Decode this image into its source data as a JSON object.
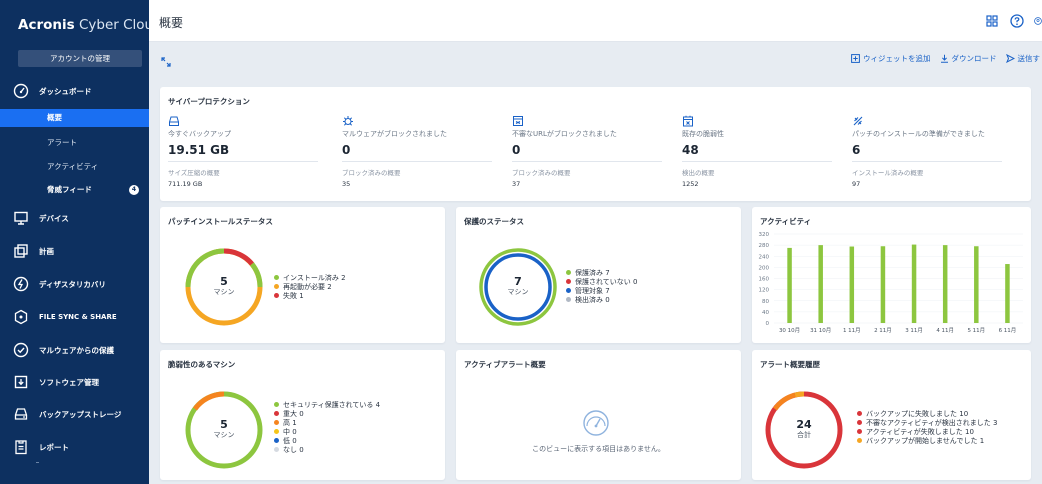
{
  "brand": {
    "name_bold": "Acronis",
    "name_rest": " Cyber Cloud"
  },
  "sidebar": {
    "account_button": "アカウントの管理",
    "items": [
      {
        "label": "ダッシュボード",
        "icon": "dashboard-icon"
      },
      {
        "label": "デバイス",
        "icon": "monitor-icon"
      },
      {
        "label": "計画",
        "icon": "plans-icon"
      },
      {
        "label": "ディザスタリカバリ",
        "icon": "disaster-recovery-icon"
      },
      {
        "label": "FILE SYNC & SHARE",
        "icon": "file-sync-icon"
      },
      {
        "label": "マルウェアからの保護",
        "icon": "shield-check-icon"
      },
      {
        "label": "ソフトウェア管理",
        "icon": "software-icon"
      },
      {
        "label": "バックアップストレージ",
        "icon": "storage-icon"
      },
      {
        "label": "レポート",
        "icon": "report-icon"
      }
    ],
    "sub_items": [
      {
        "label": "概要",
        "active": true
      },
      {
        "label": "アラート"
      },
      {
        "label": "アクティビティ"
      },
      {
        "label": "脅威フィード",
        "badge": "4"
      }
    ]
  },
  "header": {
    "title": "概要"
  },
  "toolbar": {
    "add_widget": "ウィジェットを追加",
    "download": "ダウンロード",
    "send": "送信す"
  },
  "protection": {
    "title": "サイバープロテクション",
    "columns": [
      {
        "label": "今すぐバックアップ",
        "value": "19.51 GB",
        "sub_label": "サイズ圧縮の概要",
        "sub_value": "711.19 GB",
        "icon": "backup-icon"
      },
      {
        "label": "マルウェアがブロックされました",
        "value": "0",
        "sub_label": "ブロック済みの概要",
        "sub_value": "35",
        "icon": "malware-icon"
      },
      {
        "label": "不審なURLがブロックされました",
        "value": "0",
        "sub_label": "ブロック済みの概要",
        "sub_value": "37",
        "icon": "url-block-icon"
      },
      {
        "label": "既存の脆弱性",
        "value": "48",
        "sub_label": "検出の概要",
        "sub_value": "1252",
        "icon": "vulnerability-icon"
      },
      {
        "label": "パッチのインストールの準備ができました",
        "value": "6",
        "sub_label": "インストール済みの概要",
        "sub_value": "97",
        "icon": "patch-icon"
      }
    ]
  },
  "patch_widget": {
    "title": "パッチインストールステータス",
    "center_value": "5",
    "center_unit": "マシン",
    "legend": [
      {
        "label": "インストール済み",
        "value": "2",
        "color": "#8dc63f"
      },
      {
        "label": "再起動が必要",
        "value": "2",
        "color": "#f5a623"
      },
      {
        "label": "失敗",
        "value": "1",
        "color": "#d9353a"
      }
    ]
  },
  "protection_status_widget": {
    "title": "保護のステータス",
    "center_value": "7",
    "center_unit": "マシン",
    "legend": [
      {
        "label": "保護済み",
        "value": "7",
        "color": "#8dc63f"
      },
      {
        "label": "保護されていない",
        "value": "0",
        "color": "#d9353a"
      },
      {
        "label": "管理対象",
        "value": "7",
        "color": "#1a62c7"
      },
      {
        "label": "検出済み",
        "value": "0",
        "color": "#b0b8c4"
      }
    ]
  },
  "activity_widget": {
    "title": "アクティビティ"
  },
  "vulnerable_widget": {
    "title": "脆弱性のあるマシン",
    "center_value": "5",
    "center_unit": "マシン",
    "legend": [
      {
        "label": "セキュリティ保護されている",
        "value": "4",
        "color": "#8dc63f"
      },
      {
        "label": "重大",
        "value": "0",
        "color": "#d9353a"
      },
      {
        "label": "高",
        "value": "1",
        "color": "#f5841f"
      },
      {
        "label": "中",
        "value": "0",
        "color": "#f5c518"
      },
      {
        "label": "低",
        "value": "0",
        "color": "#1a62c7"
      },
      {
        "label": "なし",
        "value": "0",
        "color": "#d5dae1"
      }
    ]
  },
  "active_alerts_widget": {
    "title": "アクティブアラート概要",
    "empty_message": "このビューに表示する項目はありません。"
  },
  "alert_history_widget": {
    "title": "アラート概要履歴",
    "center_value": "24",
    "center_unit": "合計",
    "legend": [
      {
        "label": "バックアップに失敗しました",
        "value": "10",
        "color": "#d9353a"
      },
      {
        "label": "不審なアクティビティが検出されました",
        "value": "3",
        "color": "#d9353a"
      },
      {
        "label": "アクティビティが失敗しました",
        "value": "10",
        "color": "#d9353a"
      },
      {
        "label": "バックアップが開始しませんでした",
        "value": "1",
        "color": "#f5a623"
      }
    ]
  },
  "chart_data": {
    "type": "bar",
    "title": "アクティビティ",
    "categories": [
      "30 10月",
      "31 10月",
      "1 11月",
      "2 11月",
      "3 11月",
      "4 11月",
      "5 11月",
      "6 11月"
    ],
    "series": [
      {
        "values": [
          270,
          280,
          275,
          276,
          282,
          280,
          276,
          212
        ]
      }
    ],
    "yticks": [
      0,
      40,
      80,
      120,
      160,
      200,
      240,
      280,
      320
    ],
    "ylim": [
      0,
      320
    ],
    "grid": true,
    "bar_color": "#8dc63f"
  }
}
